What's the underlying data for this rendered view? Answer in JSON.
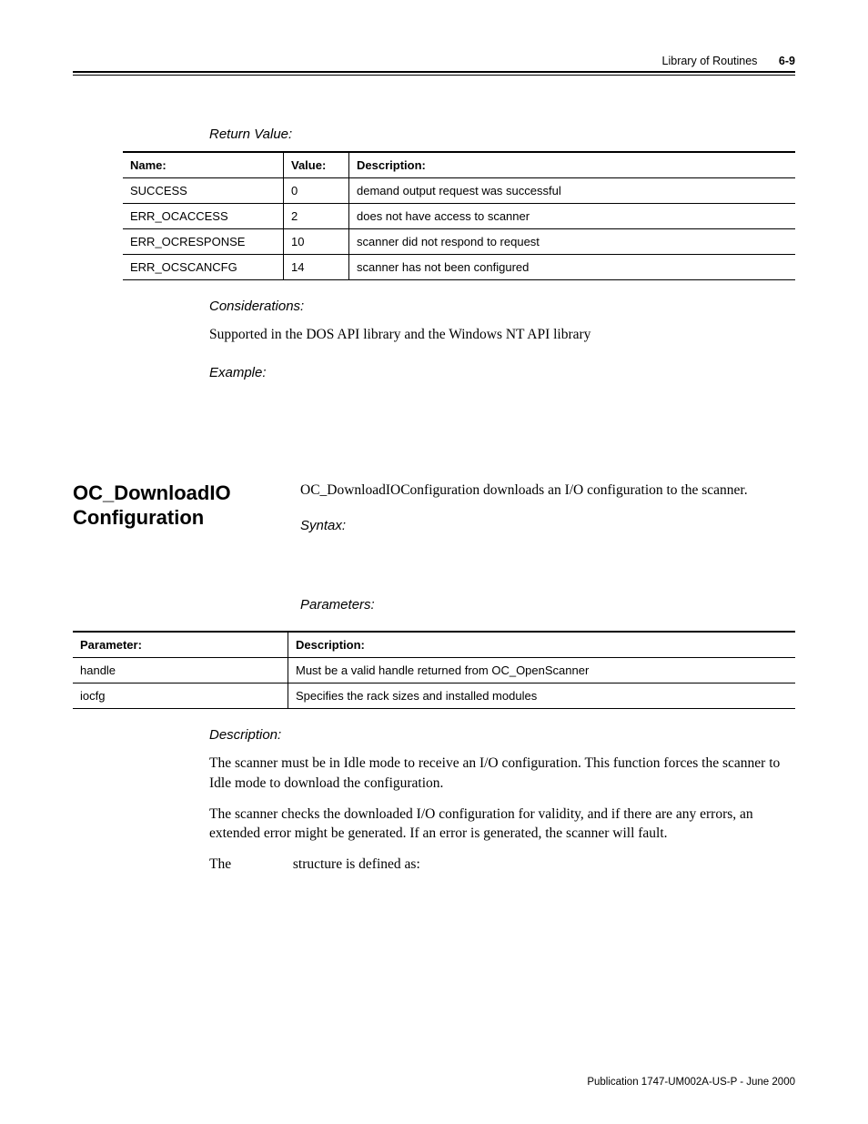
{
  "header": {
    "running_title": "Library of Routines",
    "page_number": "6-9"
  },
  "top": {
    "return_value_heading": "Return Value:",
    "table_headers": {
      "name": "Name:",
      "value": "Value:",
      "description": "Description:"
    },
    "rows": [
      {
        "name": "SUCCESS",
        "value": "0",
        "desc": "demand output request was successful"
      },
      {
        "name": "ERR_OCACCESS",
        "value": "2",
        "desc": "does not have access to scanner",
        "desc_indent": true
      },
      {
        "name": "ERR_OCRESPONSE",
        "value": "10",
        "desc": "scanner did not respond to request"
      },
      {
        "name": "ERR_OCSCANCFG",
        "value": "14",
        "desc": "scanner has not been configured"
      }
    ],
    "considerations_heading": "Considerations:",
    "considerations_text": "Supported in the DOS API library and the Windows NT API library",
    "example_heading": "Example:"
  },
  "section": {
    "title_line1": "OC_DownloadIO",
    "title_line2": "Configuration",
    "intro": "OC_DownloadIOConfiguration downloads an I/O configuration to the scanner.",
    "syntax_heading": "Syntax:",
    "parameters_heading": "Parameters:",
    "param_headers": {
      "parameter": "Parameter:",
      "description": "Description:"
    },
    "params": [
      {
        "param": "handle",
        "desc": "Must be a valid handle returned from OC_OpenScanner"
      },
      {
        "param": "iocfg",
        "desc": "Specifies the rack sizes and installed modules"
      }
    ],
    "description_heading": "Description:",
    "desc_p1": "The scanner must be in Idle mode to receive an I/O configuration. This function forces the scanner to Idle mode to download the configuration.",
    "desc_p2": "The scanner checks the downloaded I/O configuration for validity, and if there are any errors, an extended error might be generated. If an error is generated, the scanner will fault.",
    "desc_p3a": "The",
    "desc_p3b": "structure is defined as:"
  },
  "footer": {
    "pub": "Publication 1747-UM002A-US-P - June 2000"
  }
}
